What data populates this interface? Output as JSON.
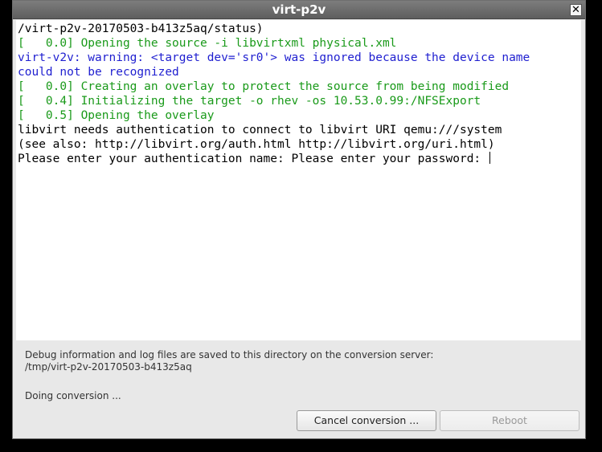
{
  "window": {
    "title": "virt-p2v"
  },
  "log_lines": [
    {
      "text": "/virt-p2v-20170503-b413z5aq/status)",
      "color": "black"
    },
    {
      "text": "[   0.0] Opening the source -i libvirtxml physical.xml",
      "color": "green"
    },
    {
      "text": "virt-v2v: warning: <target dev='sr0'> was ignored because the device name",
      "color": "blue"
    },
    {
      "text": "could not be recognized",
      "color": "blue"
    },
    {
      "text": "[   0.0] Creating an overlay to protect the source from being modified",
      "color": "green"
    },
    {
      "text": "[   0.4] Initializing the target -o rhev -os 10.53.0.99:/NFSExport",
      "color": "green"
    },
    {
      "text": "[   0.5] Opening the overlay",
      "color": "green"
    },
    {
      "text": "libvirt needs authentication to connect to libvirt URI qemu:///system",
      "color": "black"
    },
    {
      "text": "(see also: http://libvirt.org/auth.html http://libvirt.org/uri.html)",
      "color": "black"
    },
    {
      "text": "Please enter your authentication name: Please enter your password: ",
      "color": "black"
    }
  ],
  "info": {
    "line1": "Debug information and log files are saved to this directory on the conversion server:",
    "line2": "/tmp/virt-p2v-20170503-b413z5aq"
  },
  "status": "Doing conversion ...",
  "buttons": {
    "cancel": "Cancel conversion ...",
    "reboot": "Reboot"
  },
  "colors": {
    "green": "#1a9a1a",
    "blue": "#1f1fd0",
    "black": "#000000"
  }
}
